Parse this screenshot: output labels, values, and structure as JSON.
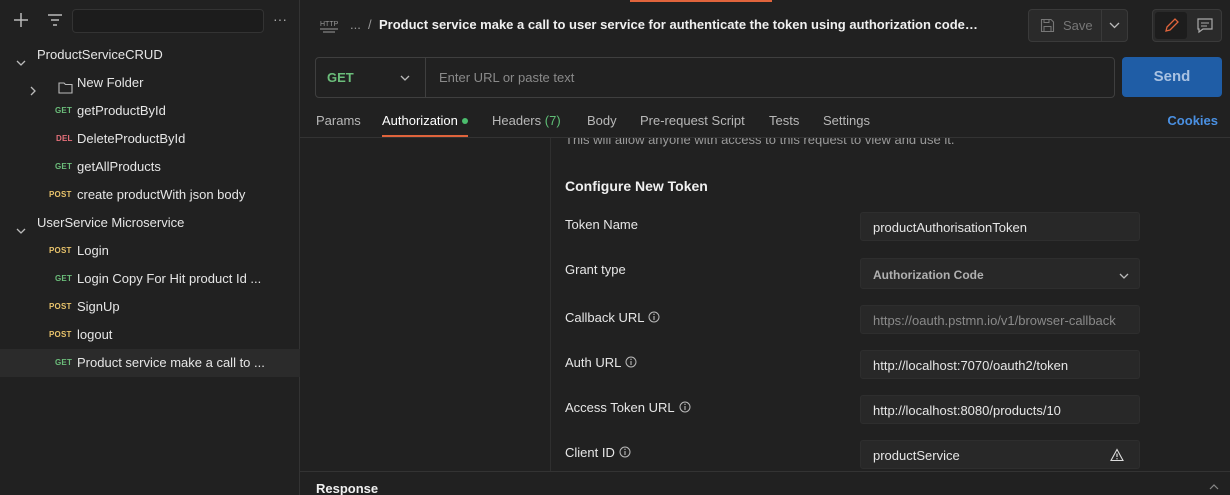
{
  "sidebar": {
    "more_label": "···",
    "items": [
      {
        "label": "ProductServiceCRUD",
        "method": "",
        "type": "collection"
      },
      {
        "label": "New Folder",
        "method": "",
        "type": "folder"
      },
      {
        "label": "getProductById",
        "method": "GET",
        "type": "request"
      },
      {
        "label": "DeleteProductById",
        "method": "DEL",
        "type": "request"
      },
      {
        "label": "getAllProducts",
        "method": "GET",
        "type": "request"
      },
      {
        "label": "create productWith json body",
        "method": "POST",
        "type": "request"
      },
      {
        "label": "UserService Microservice",
        "method": "",
        "type": "collection"
      },
      {
        "label": "Login",
        "method": "POST",
        "type": "request"
      },
      {
        "label": "Login Copy For Hit product Id ...",
        "method": "GET",
        "type": "request"
      },
      {
        "label": "SignUp",
        "method": "POST",
        "type": "request"
      },
      {
        "label": "logout",
        "method": "POST",
        "type": "request"
      },
      {
        "label": "Product service make a call to ...",
        "method": "GET",
        "type": "request",
        "selected": true
      }
    ]
  },
  "header": {
    "icon_label": "HTTP",
    "breadcrumb_dots": "...",
    "breadcrumb_sep": "/",
    "title": "Product service make a call to user service for authenticate the token using authorization code gra...",
    "save_label": "Save"
  },
  "request": {
    "method": "GET",
    "url_placeholder": "Enter URL or paste text",
    "send_label": "Send"
  },
  "tabs": {
    "params": "Params",
    "authorization": "Authorization",
    "headers": "Headers",
    "headers_count": "(7)",
    "body": "Body",
    "prerequest": "Pre-request Script",
    "tests": "Tests",
    "settings": "Settings",
    "cookies": "Cookies"
  },
  "auth": {
    "cut_text": "This will allow anyone with access to this request to view and use it.",
    "section_title": "Configure New Token",
    "token_name_label": "Token Name",
    "token_name_value": "productAuthorisationToken",
    "grant_type_label": "Grant type",
    "grant_type_value": "Authorization Code",
    "callback_url_label": "Callback URL",
    "callback_url_value": "https://oauth.pstmn.io/v1/browser-callback",
    "auth_url_label": "Auth URL",
    "auth_url_value": "http://localhost:7070/oauth2/token",
    "access_token_url_label": "Access Token URL",
    "access_token_url_value": "http://localhost:8080/products/10",
    "client_id_label": "Client ID",
    "client_id_value": "productService"
  },
  "response": {
    "label": "Response"
  },
  "colors": {
    "accent": "#e0643c",
    "send": "#1f5da6",
    "get": "#6bbd7a",
    "post": "#e8c36b",
    "delete": "#e6707a",
    "link": "#4a90e2"
  }
}
